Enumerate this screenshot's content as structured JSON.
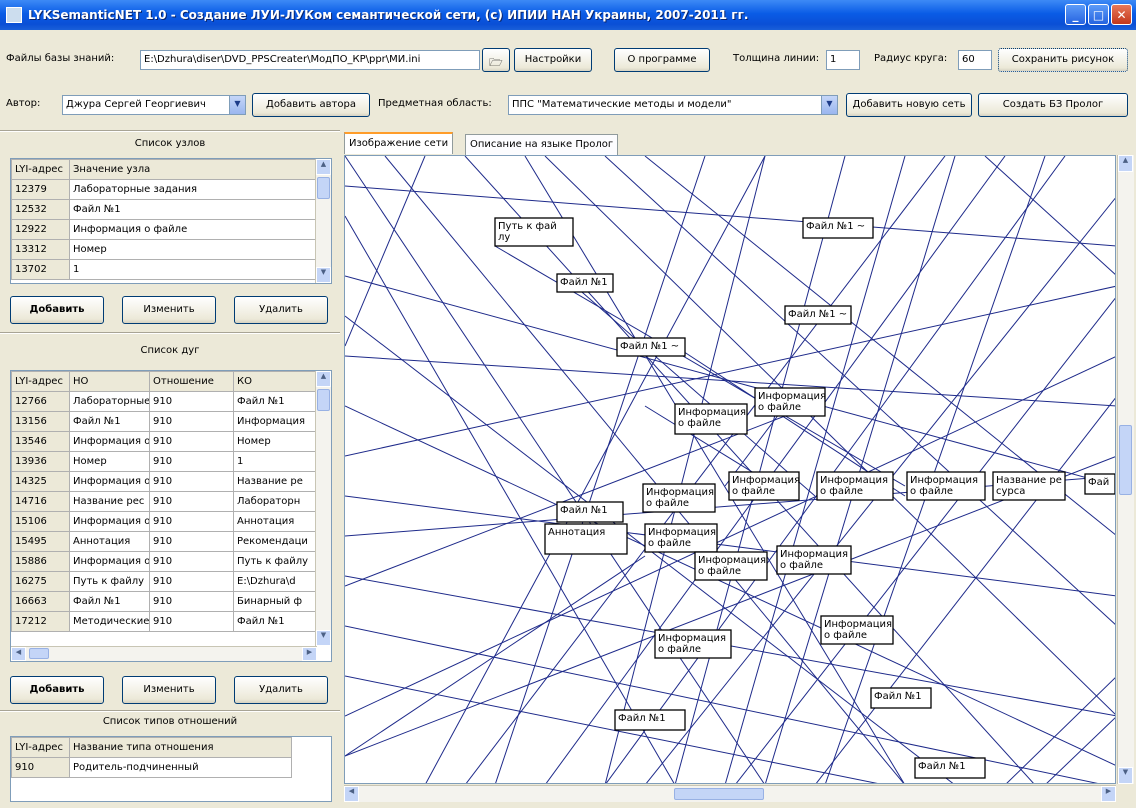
{
  "window": {
    "title": "LYKSemanticNET 1.0 - Создание ЛУИ-ЛУКом семантической сети, (с) ИПИИ НАН Украины, 2007-2011 гг.",
    "controls": [
      "_",
      "□",
      "✕"
    ]
  },
  "toolbar1": {
    "kb_files_label": "Файлы базы знаний:",
    "kb_files_value": "E:\\Dzhura\\diser\\DVD_PPSCreater\\МодПО_КР\\ppr\\МИ.ini",
    "settings_btn": "Настройки",
    "about_btn": "О программе",
    "line_width_label": "Толщина линии:",
    "line_width_value": "1",
    "circle_radius_label": "Радиус круга:",
    "circle_radius_value": "60",
    "save_picture_btn": "Сохранить рисунок"
  },
  "toolbar2": {
    "author_label": "Автор:",
    "author_value": "Джура Сергей Георгиевич",
    "add_author_btn": "Добавить автора",
    "subject_label": "Предметная область:",
    "subject_value": "ППС \"Математические методы и модели\"",
    "add_network_btn": "Добавить новую сеть",
    "create_prolog_btn": "Создать БЗ Пролог"
  },
  "nodes_list": {
    "title": "Список узлов",
    "headers": [
      "LYI-адрес",
      "Значение узла"
    ],
    "rows": [
      [
        "12379",
        "Лабораторные задания"
      ],
      [
        "12532",
        "Файл №1"
      ],
      [
        "12922",
        "Информация о файле"
      ],
      [
        "13312",
        "Номер"
      ],
      [
        "13702",
        "1"
      ]
    ],
    "add_btn": "Добавить",
    "edit_btn": "Изменить",
    "delete_btn": "Удалить"
  },
  "arcs_list": {
    "title": "Список дуг",
    "headers": [
      "LYI-адрес",
      "НО",
      "Отношение",
      "КО"
    ],
    "rows": [
      [
        "12766",
        "Лабораторные з",
        "910",
        "Файл №1"
      ],
      [
        "13156",
        "Файл №1",
        "910",
        "Информация"
      ],
      [
        "13546",
        "Информация о",
        "910",
        "Номер"
      ],
      [
        "13936",
        "Номер",
        "910",
        "1"
      ],
      [
        "14325",
        "Информация о",
        "910",
        "Название ре"
      ],
      [
        "14716",
        "Название рес",
        "910",
        "Лабораторн"
      ],
      [
        "15106",
        "Информация о",
        "910",
        "Аннотация"
      ],
      [
        "15495",
        "Аннотация",
        "910",
        "Рекомендаци"
      ],
      [
        "15886",
        "Информация о",
        "910",
        "Путь к файлу"
      ],
      [
        "16275",
        "Путь к файлу",
        "910",
        "E:\\Dzhura\\d"
      ],
      [
        "16663",
        "Файл №1",
        "910",
        "Бинарный ф"
      ],
      [
        "17212",
        "Методические",
        "910",
        "Файл №1"
      ]
    ],
    "add_btn": "Добавить",
    "edit_btn": "Изменить",
    "delete_btn": "Удалить"
  },
  "relation_types": {
    "title": "Список типов отношений",
    "headers": [
      "LYI-адрес",
      "Название типа отношения"
    ],
    "rows": [
      [
        "910",
        "Родитель-подчиненный"
      ]
    ]
  },
  "tabs": [
    "Изображение сети",
    "Описание на языке Пролог"
  ],
  "network": {
    "nodes": [
      {
        "id": "n1",
        "lines": [
          "Путь к фай",
          "лу"
        ]
      },
      {
        "id": "n2",
        "lines": [
          "Файл №1 ~"
        ]
      },
      {
        "id": "n3",
        "lines": [
          "Файл №1"
        ]
      },
      {
        "id": "n4",
        "lines": [
          "Файл №1 ~"
        ]
      },
      {
        "id": "n5",
        "lines": [
          "Файл №1 ~"
        ]
      },
      {
        "id": "n6",
        "lines": [
          "Информация",
          "о файле"
        ]
      },
      {
        "id": "n7",
        "lines": [
          "Информация",
          "о файле"
        ]
      },
      {
        "id": "n8",
        "lines": [
          "Информация",
          "о файле"
        ]
      },
      {
        "id": "n9",
        "lines": [
          "Информация",
          "о файле"
        ]
      },
      {
        "id": "n10",
        "lines": [
          "Информация",
          "о файле"
        ]
      },
      {
        "id": "n11",
        "lines": [
          "Название ре",
          "сурса"
        ]
      },
      {
        "id": "n12",
        "lines": [
          "Фай"
        ]
      },
      {
        "id": "n13",
        "lines": [
          "Информация",
          "о файле"
        ]
      },
      {
        "id": "n14",
        "lines": [
          "Файл №1"
        ]
      },
      {
        "id": "n15",
        "lines": [
          "Аннотация"
        ]
      },
      {
        "id": "n16",
        "lines": [
          "Информация",
          "о файле"
        ]
      },
      {
        "id": "n17",
        "lines": [
          "Информация",
          "о файле"
        ]
      },
      {
        "id": "n18",
        "lines": [
          "Информация",
          "о файле"
        ]
      },
      {
        "id": "n19",
        "lines": [
          "Информация",
          "о файле"
        ]
      },
      {
        "id": "n20",
        "lines": [
          "Информация",
          "о файле"
        ]
      },
      {
        "id": "n21",
        "lines": [
          "Файл №1"
        ]
      },
      {
        "id": "n22",
        "lines": [
          "Файл №1"
        ]
      },
      {
        "id": "n23",
        "lines": [
          "Файл №1"
        ]
      }
    ]
  }
}
